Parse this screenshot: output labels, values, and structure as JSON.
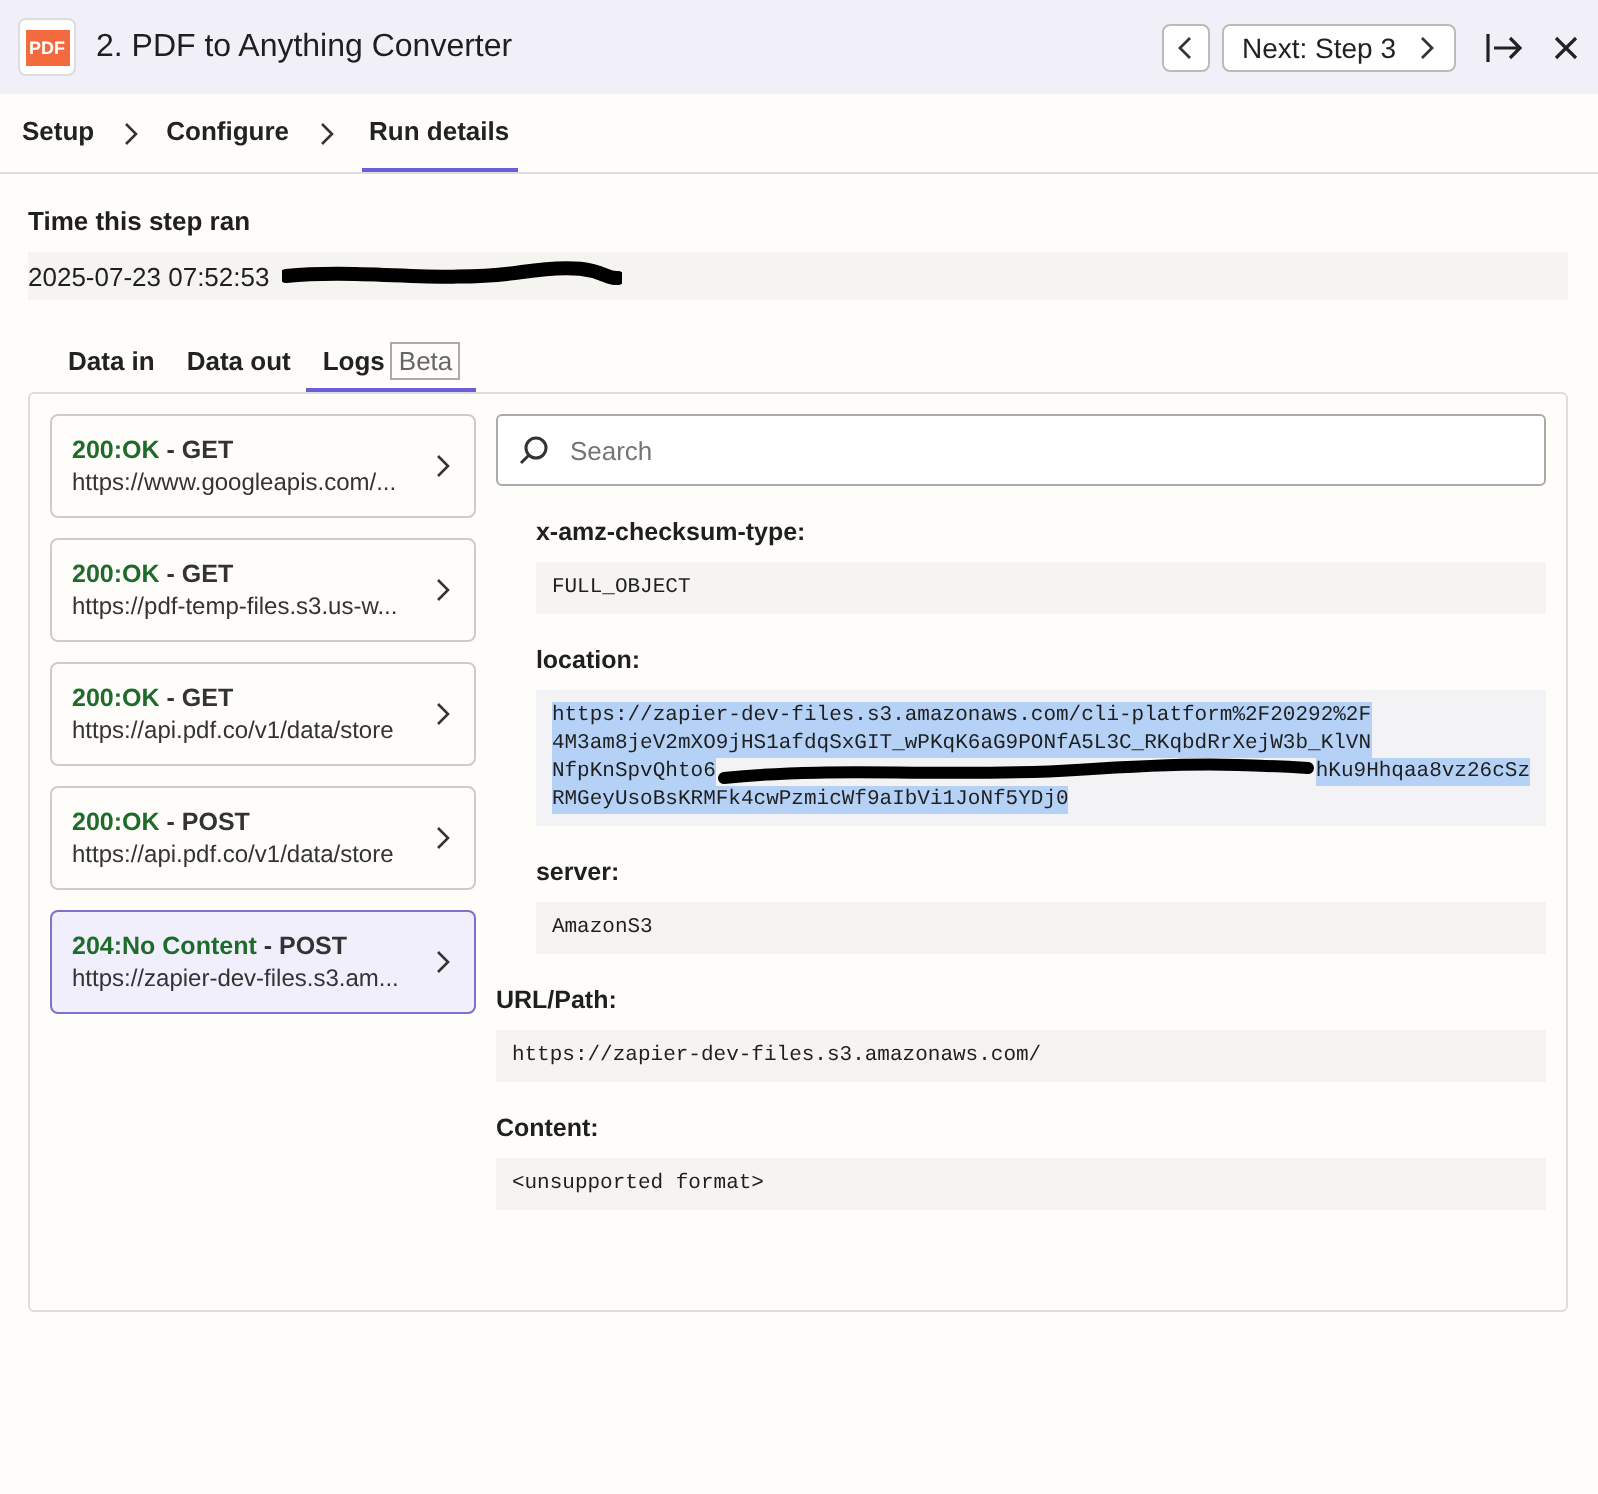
{
  "header": {
    "app_icon_text": "PDF",
    "title": "2. PDF to Anything Converter",
    "next_button": "Next: Step 3"
  },
  "steps": [
    {
      "label": "Setup",
      "selected": false
    },
    {
      "label": "Configure",
      "selected": false
    },
    {
      "label": "Run details",
      "selected": true
    }
  ],
  "run_time": {
    "label": "Time this step ran",
    "value": "2025-07-23 07:52:53",
    "redacted": true
  },
  "tabs": [
    {
      "label": "Data in",
      "selected": false
    },
    {
      "label": "Data out",
      "selected": false
    },
    {
      "label": "Logs",
      "badge": "Beta",
      "selected": true
    }
  ],
  "requests": [
    {
      "status": "200:OK",
      "method": "- GET",
      "url": "https://www.googleapis.com/...",
      "selected": false
    },
    {
      "status": "200:OK",
      "method": "- GET",
      "url": "https://pdf-temp-files.s3.us-w...",
      "selected": false
    },
    {
      "status": "200:OK",
      "method": "- GET",
      "url": "https://api.pdf.co/v1/data/store",
      "selected": false
    },
    {
      "status": "200:OK",
      "method": "- POST",
      "url": "https://api.pdf.co/v1/data/store",
      "selected": false
    },
    {
      "status": "204:No Content",
      "method": "- POST",
      "url": "https://zapier-dev-files.s3.am...",
      "selected": true
    }
  ],
  "search": {
    "placeholder": "Search"
  },
  "fields": [
    {
      "label": "x-amz-checksum-type:",
      "indented": true,
      "highlighted": false,
      "lines": [
        [
          {
            "kind": "text",
            "text": "FULL_OBJECT"
          }
        ]
      ]
    },
    {
      "label": "location:",
      "indented": true,
      "highlighted": true,
      "lines": [
        [
          {
            "kind": "text",
            "text": "https://zapier-dev-files.s3.amazonaws.com/cli-platform%2F20292%2F"
          }
        ],
        [
          {
            "kind": "text",
            "text": "4M3am8jeV2mXO9jHS1afdqSxGIT_wPKqK6aG9PONfA5L3C_RKqbdRrXejW3b_KlVN"
          }
        ],
        [
          {
            "kind": "text",
            "text": "NfpKnSpvQhto6"
          },
          {
            "kind": "redaction"
          },
          {
            "kind": "text",
            "text": "hKu9Hhqaa8vz26cSz"
          }
        ],
        [
          {
            "kind": "text",
            "text": "RMGeyUsoBsKRMFk4cwPzmicWf9aIbVi1JoNf5YDj0"
          }
        ]
      ]
    },
    {
      "label": "server:",
      "indented": true,
      "highlighted": false,
      "lines": [
        [
          {
            "kind": "text",
            "text": "AmazonS3"
          }
        ]
      ]
    },
    {
      "label": "URL/Path:",
      "indented": false,
      "highlighted": false,
      "lines": [
        [
          {
            "kind": "text",
            "text": "https://zapier-dev-files.s3.amazonaws.com/"
          }
        ]
      ]
    },
    {
      "label": "Content:",
      "indented": false,
      "highlighted": false,
      "lines": [
        [
          {
            "kind": "text",
            "text": "<unsupported format>"
          }
        ]
      ]
    }
  ]
}
